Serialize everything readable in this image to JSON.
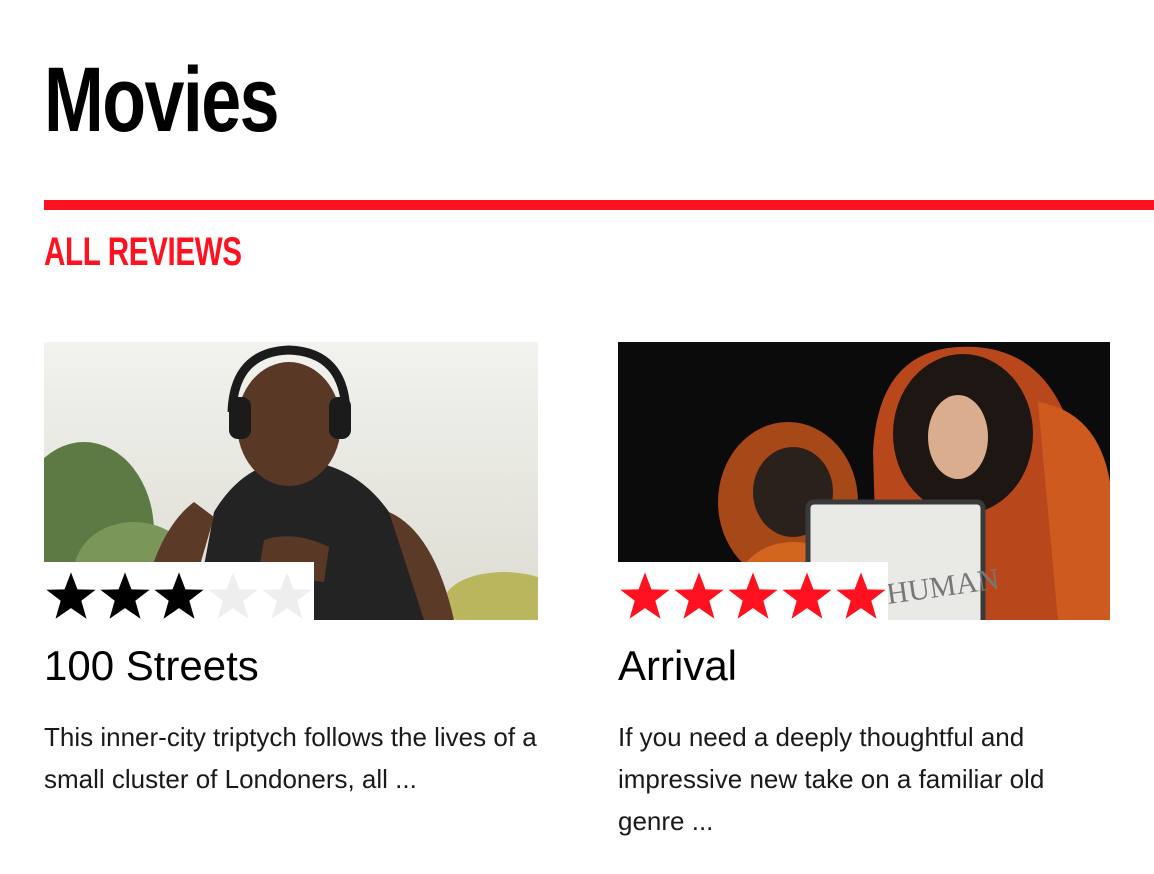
{
  "page": {
    "title": "Movies",
    "section_title": "ALL REVIEWS",
    "accent_color": "#ff1120"
  },
  "reviews": [
    {
      "title": "100 Streets",
      "excerpt": "This inner-city triptych follows the lives of a small cluster of Londoners, all ...",
      "rating": 3,
      "rating_max": 5,
      "star_color": "#000000",
      "star_empty_color": "#eeeeee",
      "image": "man-running-headphones-photo"
    },
    {
      "title": "Arrival",
      "excerpt": "If you need a deeply thoughtful and impressive new take on a familiar old genre ...",
      "rating": 5,
      "rating_max": 5,
      "star_color": "#ff1120",
      "star_empty_color": "#eeeeee",
      "image": "astronauts-orange-suits-photo"
    }
  ]
}
